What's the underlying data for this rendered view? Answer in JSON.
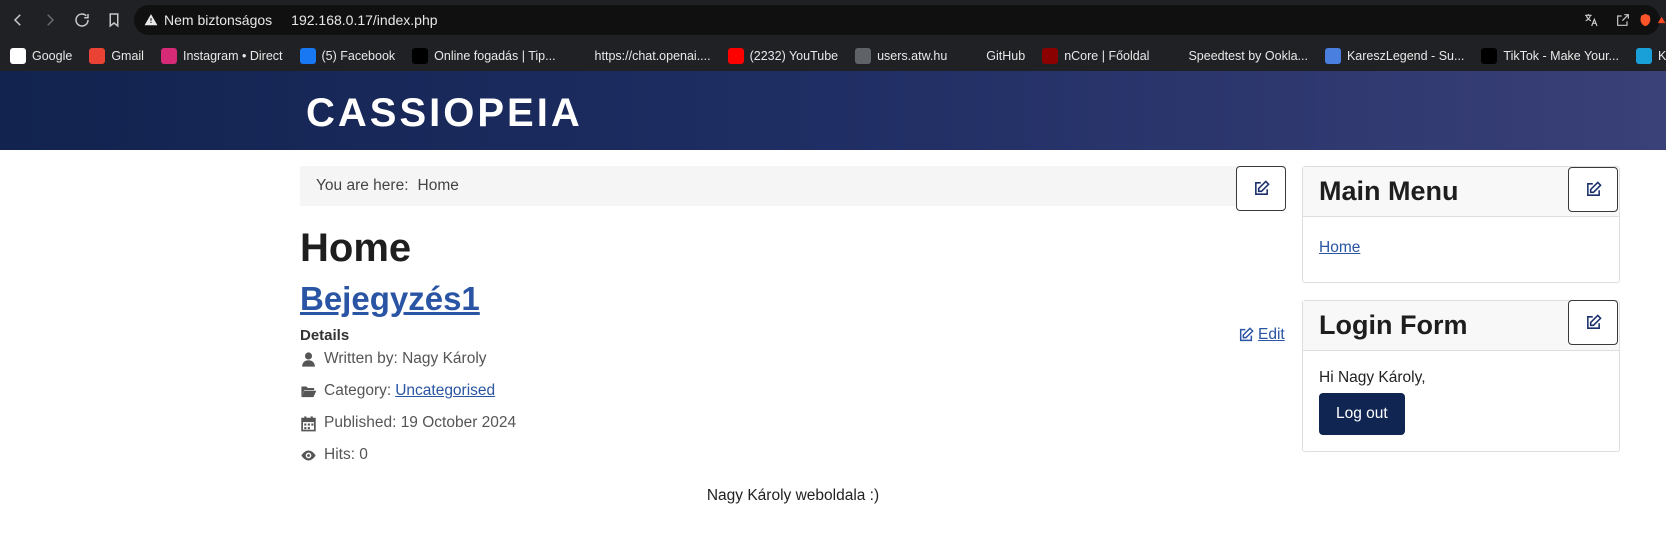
{
  "browser": {
    "security_label": "Nem biztonságos",
    "url": "192.168.0.17/index.php",
    "bookmarks": [
      {
        "label": "Google",
        "color": "#ffffff"
      },
      {
        "label": "Gmail",
        "color": "#ea4335"
      },
      {
        "label": "Instagram • Direct",
        "color": "#d62976"
      },
      {
        "label": "(5) Facebook",
        "color": "#1877f2"
      },
      {
        "label": "Online fogadás | Tip...",
        "color": "#000000"
      },
      {
        "label": "https://chat.openai....",
        "color": "#202124"
      },
      {
        "label": "(2232) YouTube",
        "color": "#ff0000"
      },
      {
        "label": "users.atw.hu",
        "color": "#5f6368"
      },
      {
        "label": "GitHub",
        "color": "#202124"
      },
      {
        "label": "nCore | Főoldal",
        "color": "#8b0000"
      },
      {
        "label": "Speedtest by Ookla...",
        "color": "#202124"
      },
      {
        "label": "KareszLegend - Su...",
        "color": "#4a7fe0"
      },
      {
        "label": "TikTok - Make Your...",
        "color": "#000000"
      },
      {
        "label": "KRÉTA Beje",
        "color": "#1aa0d8"
      }
    ]
  },
  "site": {
    "brand": "CASSIOPEIA"
  },
  "breadcrumb": {
    "prefix": "You are here:",
    "current": "Home"
  },
  "main": {
    "page_title": "Home",
    "article_title": "Bejegyzés1",
    "details_label": "Details",
    "edit_label": "Edit",
    "author": "Written by: Nagy Károly",
    "category_prefix": "Category:",
    "category": "Uncategorised",
    "published": "Published: 19 October 2024",
    "hits": "Hits: 0",
    "body": "Nagy Károly weboldala :)"
  },
  "sidebar": {
    "menu_title": "Main Menu",
    "menu_items": [
      "Home"
    ],
    "login_title": "Login Form",
    "greeting": "Hi Nagy Károly,",
    "logout_label": "Log out"
  },
  "colors": {
    "accent": "#2a54a4",
    "header_dark": "#12234f",
    "button_dark": "#112553"
  }
}
